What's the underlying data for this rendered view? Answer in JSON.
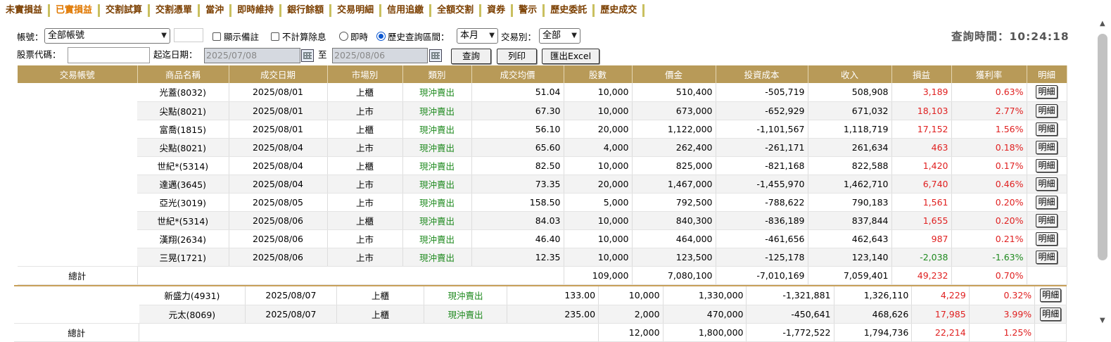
{
  "tabs": [
    "未實損益",
    "已實損益",
    "交割試算",
    "交割憑單",
    "當沖",
    "即時維持",
    "銀行餘額",
    "交易明細",
    "信用追繳",
    "全額交割",
    "資券",
    "警示",
    "歷史委託",
    "歷史成交"
  ],
  "filters": {
    "account_label": "帳號：",
    "account_value": "全部帳號",
    "show_note": "顯示備註",
    "exclude_dividend": "不計算除息",
    "realtime": "即時",
    "history_range": "歷史查詢區間：",
    "period_value": "本月",
    "trade_type_label": "交易別：",
    "trade_type_value": "全部",
    "stock_code_label": "股票代碼：",
    "date_range_label": "起迄日期：",
    "start_date": "2025/07/08",
    "to_label": "至",
    "end_date": "2025/08/06",
    "query_button": "查詢",
    "print_button": "列印",
    "export_button": "匯出Excel"
  },
  "query_time_label": "查詢時間：",
  "query_time": "10:24:18",
  "table": {
    "headers": [
      "交易帳號",
      "商品名稱",
      "成交日期",
      "市場別",
      "類別",
      "成交均價",
      "股數",
      "價金",
      "投資成本",
      "收入",
      "損益",
      "獲利率",
      "明細"
    ],
    "detail_label": "明細",
    "group1": [
      {
        "name": "光蓋(8032)",
        "date": "2025/08/01",
        "market": "上櫃",
        "type": "現沖賣出",
        "price": "51.04",
        "shares": "10,000",
        "amount": "510,400",
        "cost": "-505,719",
        "income": "508,908",
        "pl": "3,189",
        "rate": "0.63%"
      },
      {
        "name": "尖點(8021)",
        "date": "2025/08/01",
        "market": "上市",
        "type": "現沖賣出",
        "price": "67.30",
        "shares": "10,000",
        "amount": "673,000",
        "cost": "-652,929",
        "income": "671,032",
        "pl": "18,103",
        "rate": "2.77%"
      },
      {
        "name": "富喬(1815)",
        "date": "2025/08/01",
        "market": "上櫃",
        "type": "現沖賣出",
        "price": "56.10",
        "shares": "20,000",
        "amount": "1,122,000",
        "cost": "-1,101,567",
        "income": "1,118,719",
        "pl": "17,152",
        "rate": "1.56%"
      },
      {
        "name": "尖點(8021)",
        "date": "2025/08/04",
        "market": "上市",
        "type": "現沖賣出",
        "price": "65.60",
        "shares": "4,000",
        "amount": "262,400",
        "cost": "-261,171",
        "income": "261,634",
        "pl": "463",
        "rate": "0.18%"
      },
      {
        "name": "世紀*(5314)",
        "date": "2025/08/04",
        "market": "上櫃",
        "type": "現沖賣出",
        "price": "82.50",
        "shares": "10,000",
        "amount": "825,000",
        "cost": "-821,168",
        "income": "822,588",
        "pl": "1,420",
        "rate": "0.17%"
      },
      {
        "name": "達邁(3645)",
        "date": "2025/08/04",
        "market": "上市",
        "type": "現沖賣出",
        "price": "73.35",
        "shares": "20,000",
        "amount": "1,467,000",
        "cost": "-1,455,970",
        "income": "1,462,710",
        "pl": "6,740",
        "rate": "0.46%"
      },
      {
        "name": "亞光(3019)",
        "date": "2025/08/05",
        "market": "上市",
        "type": "現沖賣出",
        "price": "158.50",
        "shares": "5,000",
        "amount": "792,500",
        "cost": "-788,622",
        "income": "790,183",
        "pl": "1,561",
        "rate": "0.20%"
      },
      {
        "name": "世紀*(5314)",
        "date": "2025/08/06",
        "market": "上櫃",
        "type": "現沖賣出",
        "price": "84.03",
        "shares": "10,000",
        "amount": "840,300",
        "cost": "-836,189",
        "income": "837,844",
        "pl": "1,655",
        "rate": "0.20%"
      },
      {
        "name": "漢翔(2634)",
        "date": "2025/08/06",
        "market": "上市",
        "type": "現沖賣出",
        "price": "46.40",
        "shares": "10,000",
        "amount": "464,000",
        "cost": "-461,656",
        "income": "462,643",
        "pl": "987",
        "rate": "0.21%"
      },
      {
        "name": "三晃(1721)",
        "date": "2025/08/06",
        "market": "上市",
        "type": "現沖賣出",
        "price": "12.35",
        "shares": "10,000",
        "amount": "123,500",
        "cost": "-125,178",
        "income": "123,140",
        "pl": "-2,038",
        "rate": "-1.63%"
      }
    ],
    "total1": {
      "label": "總計",
      "shares": "109,000",
      "amount": "7,080,100",
      "cost": "-7,010,169",
      "income": "7,059,401",
      "pl": "49,232",
      "rate": "0.70%"
    },
    "group2": [
      {
        "name": "新盛力(4931)",
        "date": "2025/08/07",
        "market": "上櫃",
        "type": "現沖賣出",
        "price": "133.00",
        "shares": "10,000",
        "amount": "1,330,000",
        "cost": "-1,321,881",
        "income": "1,326,110",
        "pl": "4,229",
        "rate": "0.32%"
      },
      {
        "name": "元太(8069)",
        "date": "2025/08/07",
        "market": "上櫃",
        "type": "現沖賣出",
        "price": "235.00",
        "shares": "2,000",
        "amount": "470,000",
        "cost": "-450,641",
        "income": "468,626",
        "pl": "17,985",
        "rate": "3.99%"
      }
    ],
    "total2": {
      "label": "總計",
      "shares": "12,000",
      "amount": "1,800,000",
      "cost": "-1,772,522",
      "income": "1,794,736",
      "pl": "22,214",
      "rate": "1.25%"
    }
  }
}
